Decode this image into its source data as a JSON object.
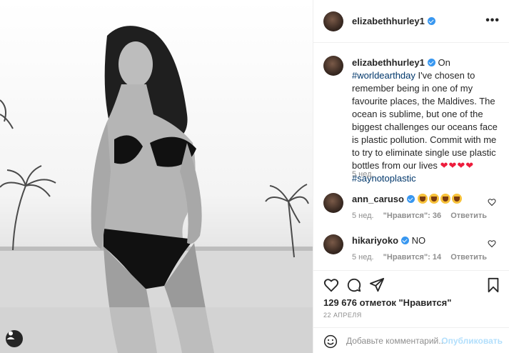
{
  "post": {
    "username": "elizabethhurley1",
    "more_label": "•••",
    "caption": {
      "username": "elizabethhurley1",
      "text_part1": "On",
      "hashtag1": "#worldearthday",
      "text_part2": "I've chosen to remember being in one of my favourite places, the Maldives. The ocean is sublime, but one of the biggest challenges our oceans face is plastic pollution. Commit with me to try to eliminate single use plastic bottles from our lives",
      "hearts": "❤❤❤❤",
      "hashtag2": "#saynotoplastic",
      "time": "5 нед."
    },
    "comments": [
      {
        "username": "ann_caruso",
        "text": "",
        "time": "5 нед.",
        "likes": "\"Нравится\": 36",
        "reply": "Ответить"
      },
      {
        "username": "hikariyoko",
        "text": "NO",
        "time": "5 нед.",
        "likes": "\"Нравится\": 14",
        "reply": "Ответить"
      }
    ],
    "likes_text": "129 676 отметок \"Нравится\"",
    "date": "22 АПРЕЛЯ",
    "add_comment_placeholder": "Добавьте комментарий...",
    "publish_label": "Опубликовать"
  },
  "icons": {
    "heart": "heart-icon",
    "comment": "comment-icon",
    "share": "share-icon",
    "bookmark": "bookmark-icon",
    "emoji": "smile-icon",
    "user_tag": "user-tag-icon"
  },
  "colors": {
    "hashtag": "#00376b",
    "verified": "#3897f0",
    "publish_disabled": "#b2dffc",
    "meta": "#8e8e8e"
  }
}
